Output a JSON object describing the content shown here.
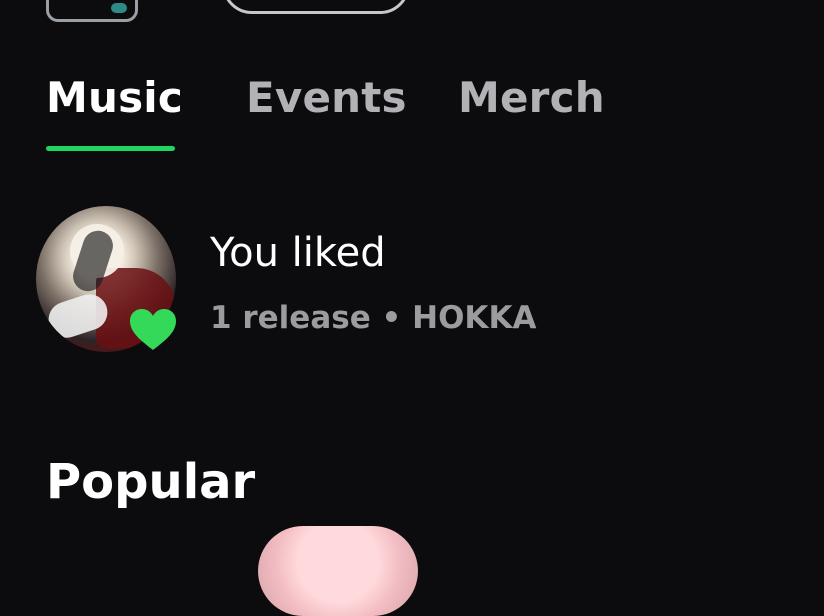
{
  "header": {
    "tabs": [
      {
        "label": "Music",
        "active": true
      },
      {
        "label": "Events",
        "active": false
      },
      {
        "label": "Merch",
        "active": false
      }
    ]
  },
  "liked": {
    "title": "You liked",
    "meta": "1 release • HOKKA",
    "icon": "heart-icon"
  },
  "sections": {
    "popular": "Popular"
  },
  "colors": {
    "background": "#0c0b0e",
    "accent": "#1ed760"
  }
}
